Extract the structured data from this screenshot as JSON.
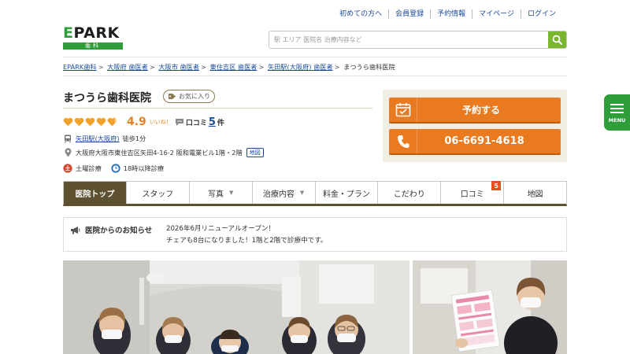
{
  "header": {
    "top_links": [
      "初めての方へ",
      "会員登録",
      "予約情報",
      "マイページ",
      "ログイン"
    ],
    "logo": {
      "main": "PARK",
      "initial": "E",
      "sub": "歯科"
    },
    "search": {
      "placeholder": "駅 エリア 医院名 治療内容など",
      "value": ""
    }
  },
  "breadcrumb": {
    "links": [
      "EPARK歯科",
      "大阪府 歯医者",
      "大阪市 歯医者",
      "東住吉区 歯医者",
      "矢田駅(大阪府) 歯医者"
    ],
    "separator": ">",
    "current": "まつうら歯科医院"
  },
  "clinic": {
    "name": "まつうら歯科医院",
    "favorite_label": "お気に入り",
    "rating": {
      "score": "4.9",
      "value": 4.9,
      "max": 5,
      "iine": "いいね！",
      "review_label": "口コミ",
      "review_count": "5",
      "review_unit": "件"
    },
    "station": {
      "name": "矢田駅(大阪府)",
      "walk": "徒歩1分"
    },
    "address": "大阪府大阪市東住吉区矢田4-16-2 阪和電業ビル1階・2階",
    "map_tag": "地図",
    "features": [
      "土曜診療",
      "18時以降診療"
    ]
  },
  "booking": {
    "reserve_label": "予約する",
    "phone": "06-6691-4618"
  },
  "side_menu": {
    "label": "MENU"
  },
  "tabs": [
    {
      "label": "医院トップ",
      "active": true,
      "dropdown": false
    },
    {
      "label": "スタッフ",
      "active": false,
      "dropdown": false
    },
    {
      "label": "写真",
      "active": false,
      "dropdown": true
    },
    {
      "label": "治療内容",
      "active": false,
      "dropdown": true
    },
    {
      "label": "料金・プラン",
      "active": false,
      "dropdown": false
    },
    {
      "label": "こだわり",
      "active": false,
      "dropdown": false
    },
    {
      "label": "口コミ",
      "active": false,
      "dropdown": false,
      "badge": "5"
    },
    {
      "label": "地図",
      "active": false,
      "dropdown": false
    }
  ],
  "notice": {
    "title": "医院からのお知らせ",
    "lines": [
      "2026年6月リニューアルオープン！",
      "チェアも8台になりました！1階と2階で診療中です。"
    ]
  },
  "colors": {
    "brand_green": "#2e9d3a",
    "search_green": "#7ab52f",
    "accent_orange": "#ea7a1f",
    "tab_brown": "#5d5132",
    "link_blue": "#1a4a9b"
  }
}
